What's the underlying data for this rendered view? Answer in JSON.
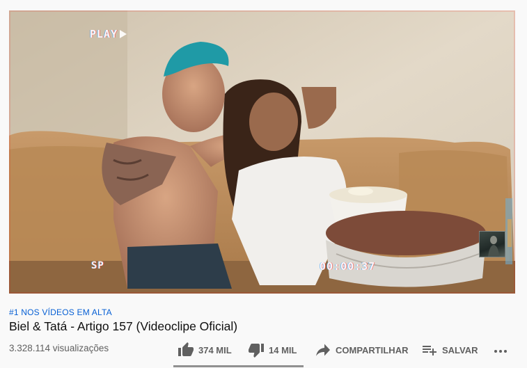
{
  "player": {
    "overlay_play": "PLAY",
    "overlay_sp": "SP",
    "overlay_timecode": "00:00:37"
  },
  "video": {
    "hashtag": "#1 NOS VÍDEOS EM ALTA",
    "title": "Biel & Tatá - Artigo 157 (Videoclipe Oficial)",
    "views": "3.328.114 visualizações"
  },
  "actions": {
    "like_count": "374 MIL",
    "dislike_count": "14 MIL",
    "share_label": "COMPARTILHAR",
    "save_label": "SALVAR"
  },
  "icons": {
    "like": "thumbs-up-icon",
    "dislike": "thumbs-down-icon",
    "share": "share-arrow-icon",
    "save": "playlist-add-icon",
    "more": "more-horizontal-icon"
  },
  "colors": {
    "link": "#065fd4",
    "text": "#0f0f0f",
    "secondary": "#606060",
    "background": "#f9f9f9"
  }
}
